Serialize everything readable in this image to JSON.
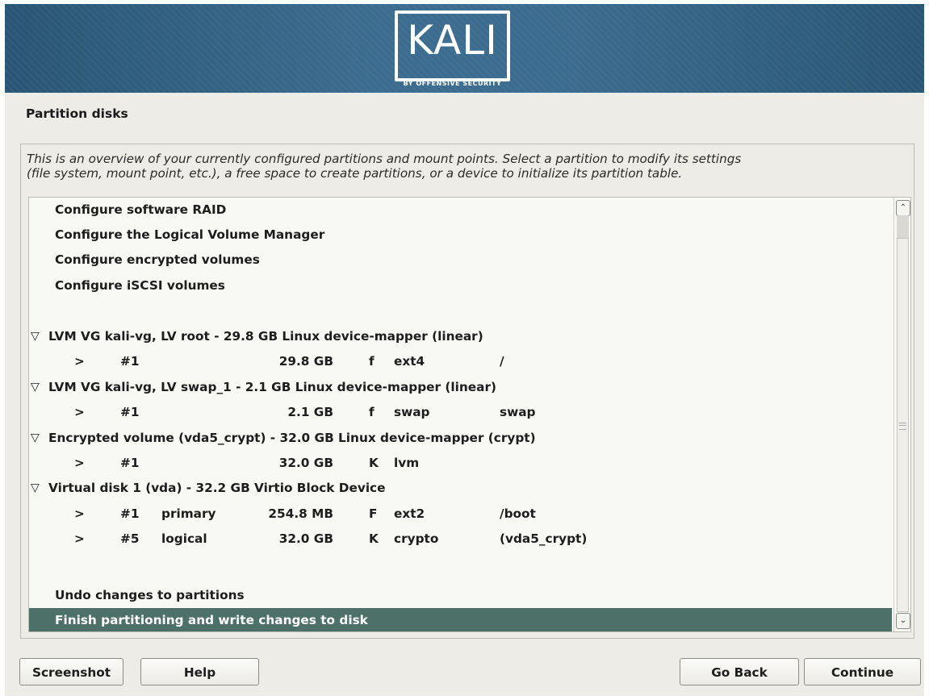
{
  "brand": {
    "logo_text": "KALI",
    "logo_subtext": "BY OFFENSIVE SECURITY"
  },
  "page": {
    "title": "Partition disks",
    "description_line1": "This is an overview of your currently configured partitions and mount points. Select a partition to modify its settings",
    "description_line2": "(file system, mount point, etc.), a free space to create partitions, or a device to initialize its partition table."
  },
  "menu": {
    "configure_raid": "Configure software RAID",
    "configure_lvm": "Configure the Logical Volume Manager",
    "configure_encrypted": "Configure encrypted volumes",
    "configure_iscsi": "Configure iSCSI volumes",
    "undo": "Undo changes to partitions",
    "finish": "Finish partitioning and write changes to disk"
  },
  "devices": [
    {
      "expander": "▽",
      "label": "LVM VG kali-vg, LV root - 29.8 GB Linux device-mapper (linear)",
      "partitions": [
        {
          "arrow": ">",
          "num": "#1",
          "type": "",
          "size": "29.8 GB",
          "flag": "f",
          "fs": "ext4",
          "mount": "/"
        }
      ]
    },
    {
      "expander": "▽",
      "label": "LVM VG kali-vg, LV swap_1 - 2.1 GB Linux device-mapper (linear)",
      "partitions": [
        {
          "arrow": ">",
          "num": "#1",
          "type": "",
          "size": "2.1 GB",
          "flag": "f",
          "fs": "swap",
          "mount": "swap"
        }
      ]
    },
    {
      "expander": "▽",
      "label": "Encrypted volume (vda5_crypt) - 32.0 GB Linux device-mapper (crypt)",
      "partitions": [
        {
          "arrow": ">",
          "num": "#1",
          "type": "",
          "size": "32.0 GB",
          "flag": "K",
          "fs": "lvm",
          "mount": ""
        }
      ]
    },
    {
      "expander": "▽",
      "label": "Virtual disk 1 (vda) - 32.2 GB Virtio Block Device",
      "partitions": [
        {
          "arrow": ">",
          "num": "#1",
          "type": "primary",
          "size": "254.8 MB",
          "flag": "F",
          "fs": "ext2",
          "mount": "/boot"
        },
        {
          "arrow": ">",
          "num": "#5",
          "type": "logical",
          "size": "32.0 GB",
          "flag": "K",
          "fs": "crypto",
          "mount": "(vda5_crypt)"
        }
      ]
    }
  ],
  "selected_item": "finish",
  "scrollbar": {
    "up_glyph": "⌃",
    "down_glyph": "⌄"
  },
  "buttons": {
    "screenshot": "Screenshot",
    "help": "Help",
    "go_back": "Go Back",
    "continue": "Continue"
  },
  "colors": {
    "banner": "#3c6c8f",
    "selection": "#4d7168",
    "background": "#edece7"
  }
}
